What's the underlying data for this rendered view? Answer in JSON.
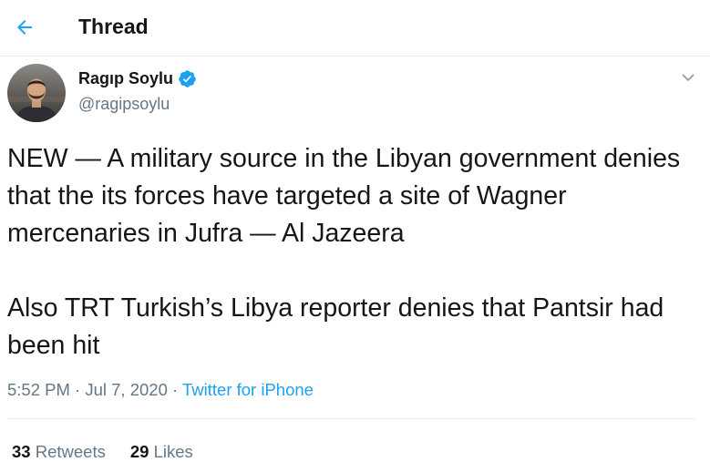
{
  "header": {
    "title": "Thread",
    "back_icon": "arrow-left-icon",
    "accent_color": "#1da1f2"
  },
  "tweet": {
    "author": {
      "name": "Ragıp Soylu",
      "handle": "@ragipsoylu",
      "verified": true,
      "verified_icon": "verified-badge-icon"
    },
    "menu_icon": "chevron-down-icon",
    "paragraphs": [
      "NEW — A military source in the Libyan government denies that the its forces have targeted a site of Wagner mercenaries in Jufra — Al Jazeera",
      "Also TRT Turkish’s Libya reporter denies that Pantsir had been hit"
    ],
    "time": "5:52 PM",
    "date": "Jul 7, 2020",
    "separator": "·",
    "source": "Twitter for iPhone",
    "stats": {
      "retweets_count": "33",
      "retweets_label": "Retweets",
      "likes_count": "29",
      "likes_label": "Likes"
    }
  }
}
